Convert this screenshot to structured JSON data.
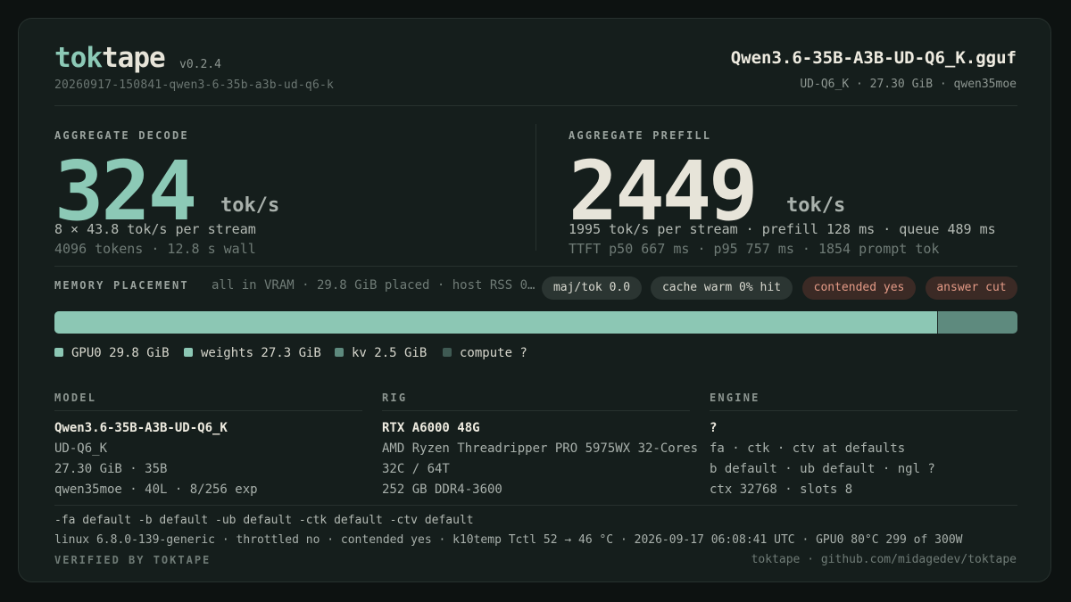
{
  "header": {
    "brand_a": "tok",
    "brand_b": "tape",
    "version": "v0.2.4",
    "run_id": "20260917-150841-qwen3-6-35b-a3b-ud-q6-k",
    "model_file": "Qwen3.6-35B-A3B-UD-Q6_K.gguf",
    "model_meta": "UD-Q6_K · 27.30 GiB · qwen35moe"
  },
  "decode": {
    "label": "AGGREGATE DECODE",
    "value": "324",
    "unit": "tok/s",
    "line1": "8 × 43.8 tok/s per stream",
    "line2": "4096 tokens · 12.8 s wall"
  },
  "prefill": {
    "label": "AGGREGATE PREFILL",
    "value": "2449",
    "unit": "tok/s",
    "line1": "1995 tok/s per stream · prefill 128 ms · queue 489 ms",
    "line2": "TTFT p50 667 ms · p95 757 ms · 1854 prompt tok"
  },
  "memory": {
    "label": "MEMORY PLACEMENT",
    "summary": "all in VRAM · 29.8 GiB placed · host RSS 0…",
    "pills": [
      {
        "text": "maj/tok 0.0",
        "kind": "neutral"
      },
      {
        "text": "cache warm 0% hit",
        "kind": "neutral"
      },
      {
        "text": "contended yes",
        "kind": "warn"
      },
      {
        "text": "answer cut",
        "kind": "warn"
      }
    ],
    "bar_fill_fraction": 0.917,
    "colors": {
      "fill": "#8cc7b4",
      "rest": "#5e8a7e"
    },
    "legend": [
      {
        "text": "GPU0 29.8 GiB",
        "color": "#8cc7b4"
      },
      {
        "text": "weights 27.3 GiB",
        "color": "#8cc7b4"
      },
      {
        "text": "kv 2.5 GiB",
        "color": "#5e8a7e"
      },
      {
        "text": "compute ?",
        "color": "#3f5a53"
      }
    ]
  },
  "model_col": {
    "title": "MODEL",
    "rows": [
      "Qwen3.6-35B-A3B-UD-Q6_K",
      "UD-Q6_K",
      "27.30 GiB · 35B",
      "qwen35moe · 40L · 8/256 exp"
    ]
  },
  "rig_col": {
    "title": "RIG",
    "rows": [
      "RTX A6000 48G",
      "AMD Ryzen Threadripper PRO 5975WX 32-Cores",
      "32C / 64T",
      "252 GB DDR4-3600"
    ]
  },
  "engine_col": {
    "title": "ENGINE",
    "rows": [
      "?",
      "fa · ctk · ctv at defaults",
      "b default · ub default · ngl ?",
      "ctx 32768 · slots 8"
    ]
  },
  "footer": {
    "flags": "-fa default  -b default  -ub default  -ctk default  -ctv default",
    "system": "linux 6.8.0-139-generic · throttled no · contended yes · k10temp Tctl 52 → 46 °C · 2026-09-17 06:08:41 UTC · GPU0 80°C 299 of 300W",
    "verified": "VERIFIED BY TOKTAPE",
    "repo": "toktape · github.com/midagedev/toktape"
  }
}
